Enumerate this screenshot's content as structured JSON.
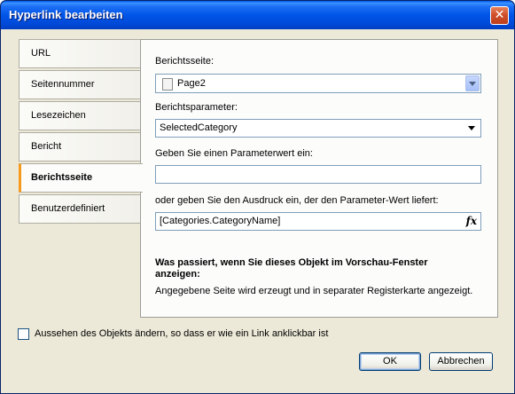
{
  "window": {
    "title": "Hyperlink bearbeiten",
    "close_symbol": "✕"
  },
  "tabs": [
    {
      "label": "URL",
      "selected": false
    },
    {
      "label": "Seitennummer",
      "selected": false
    },
    {
      "label": "Lesezeichen",
      "selected": false
    },
    {
      "label": "Bericht",
      "selected": false
    },
    {
      "label": "Berichtsseite",
      "selected": true
    },
    {
      "label": "Benutzerdefiniert",
      "selected": false
    }
  ],
  "panel": {
    "report_page_label": "Berichtsseite:",
    "report_page_value": "Page2",
    "report_param_label": "Berichtsparameter:",
    "report_param_value": "SelectedCategory",
    "param_value_label": "Geben Sie einen Parameterwert ein:",
    "param_value": "",
    "expression_label": "oder geben Sie den Ausdruck ein, der den Parameter-Wert liefert:",
    "expression_value": "[Categories.CategoryName]",
    "expression_button": "fx",
    "info_title": "Was passiert, wenn Sie dieses Objekt im Vorschau-Fenster anzeigen:",
    "info_text": "Angegebene Seite wird erzeugt und in separater Registerkarte angezeigt."
  },
  "footer": {
    "checkbox_label": "Aussehen des Objekts ändern, so dass er wie ein Link anklickbar ist",
    "checkbox_checked": false,
    "ok_label": "OK",
    "cancel_label": "Abbrechen"
  }
}
